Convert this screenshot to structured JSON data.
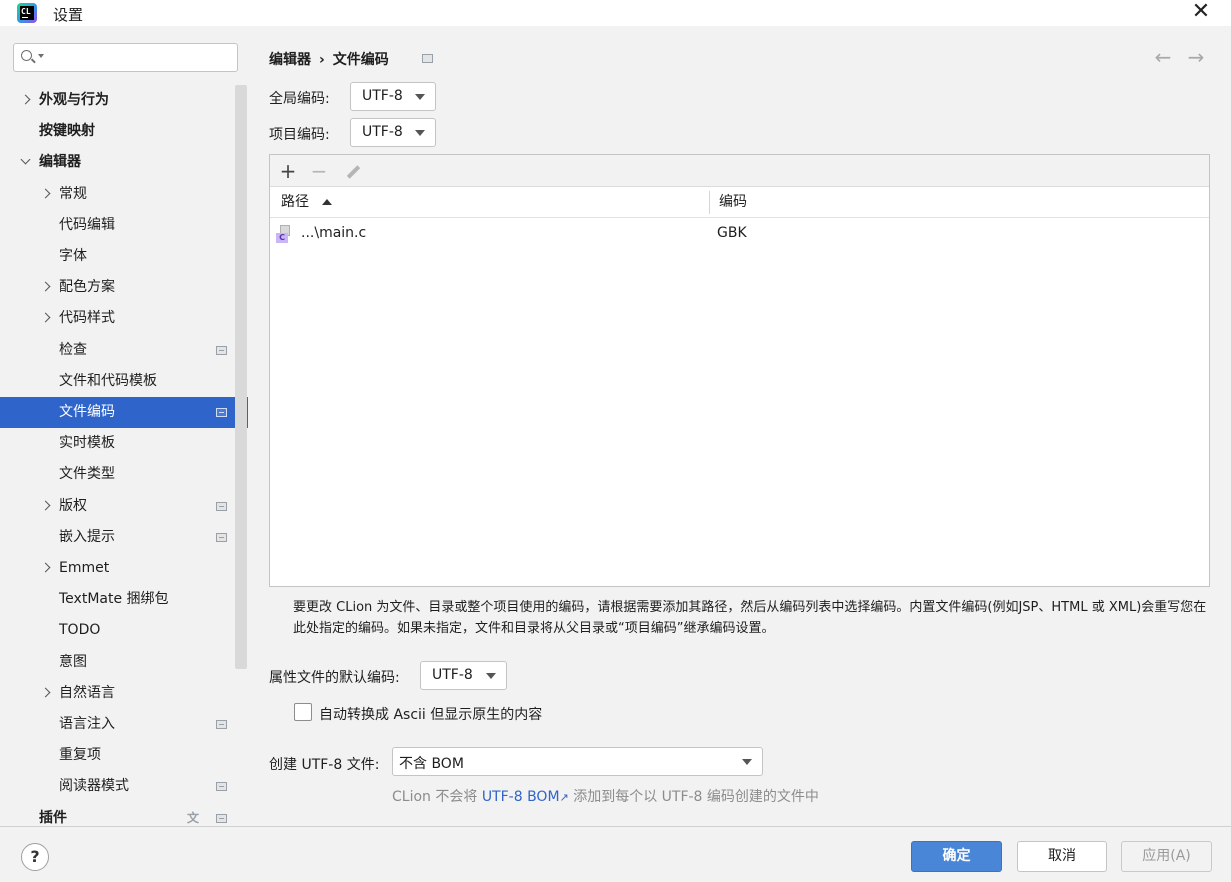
{
  "window": {
    "title": "设置",
    "logo_text": "CL"
  },
  "sidebar": {
    "search_placeholder": "",
    "items": [
      {
        "label": "外观与行为",
        "level": 0,
        "chevron": "right",
        "bold": true
      },
      {
        "label": "按键映射",
        "level": 0,
        "chevron": "none",
        "bold": true
      },
      {
        "label": "编辑器",
        "level": 0,
        "chevron": "down",
        "bold": true
      },
      {
        "label": "常规",
        "level": 1,
        "chevron": "right"
      },
      {
        "label": "代码编辑",
        "level": 1,
        "chevron": "none"
      },
      {
        "label": "字体",
        "level": 1,
        "chevron": "none"
      },
      {
        "label": "配色方案",
        "level": 1,
        "chevron": "right"
      },
      {
        "label": "代码样式",
        "level": 1,
        "chevron": "right"
      },
      {
        "label": "检查",
        "level": 1,
        "chevron": "none",
        "badge": true
      },
      {
        "label": "文件和代码模板",
        "level": 1,
        "chevron": "none"
      },
      {
        "label": "文件编码",
        "level": 1,
        "chevron": "none",
        "badge": true,
        "selected": true
      },
      {
        "label": "实时模板",
        "level": 1,
        "chevron": "none"
      },
      {
        "label": "文件类型",
        "level": 1,
        "chevron": "none"
      },
      {
        "label": "版权",
        "level": 1,
        "chevron": "right",
        "badge": true
      },
      {
        "label": "嵌入提示",
        "level": 1,
        "chevron": "none",
        "badge": true
      },
      {
        "label": "Emmet",
        "level": 1,
        "chevron": "right"
      },
      {
        "label": "TextMate 捆绑包",
        "level": 1,
        "chevron": "none"
      },
      {
        "label": "TODO",
        "level": 1,
        "chevron": "none"
      },
      {
        "label": "意图",
        "level": 1,
        "chevron": "none"
      },
      {
        "label": "自然语言",
        "level": 1,
        "chevron": "right"
      },
      {
        "label": "语言注入",
        "level": 1,
        "chevron": "none",
        "badge": true
      },
      {
        "label": "重复项",
        "level": 1,
        "chevron": "none"
      },
      {
        "label": "阅读器模式",
        "level": 1,
        "chevron": "none",
        "badge": true
      },
      {
        "label": "插件",
        "level": 0,
        "chevron": "none",
        "bold": true,
        "badge": true,
        "translate": true
      }
    ]
  },
  "main": {
    "breadcrumb": {
      "parent": "编辑器",
      "separator": "›",
      "current": "文件编码"
    },
    "global_encoding": {
      "label": "全局编码:",
      "value": "UTF-8"
    },
    "project_encoding": {
      "label": "项目编码:",
      "value": "UTF-8"
    },
    "table": {
      "columns": {
        "path": "路径",
        "encoding": "编码"
      },
      "rows": [
        {
          "path": "...\\main.c",
          "encoding": "GBK",
          "icon": "c-file-icon",
          "icon_letter": "C"
        }
      ]
    },
    "hint_text": "要更改 CLion 为文件、目录或整个项目使用的编码，请根据需要添加其路径，然后从编码列表中选择编码。内置文件编码(例如JSP、HTML 或 XML)会重写您在此处指定的编码。如果未指定，文件和目录将从父目录或“项目编码”继承编码设置。",
    "properties_encoding": {
      "label": "属性文件的默认编码:",
      "value": "UTF-8"
    },
    "transparent_ascii": {
      "label": "自动转换成 Ascii 但显示原生的内容",
      "checked": false
    },
    "create_utf8": {
      "label": "创建 UTF-8 文件:",
      "value": "不含 BOM"
    },
    "note": {
      "prefix": "CLion 不会将 ",
      "link": "UTF-8 BOM",
      "link_arrow": "↗",
      "suffix": " 添加到每个以 UTF-8 编码创建的文件中"
    }
  },
  "footer": {
    "help": "?",
    "ok": "确定",
    "cancel": "取消",
    "apply": "应用(A)"
  },
  "colors": {
    "selection": "#2f65ca",
    "ok_button": "#4a86d8",
    "link": "#2f65ca"
  }
}
